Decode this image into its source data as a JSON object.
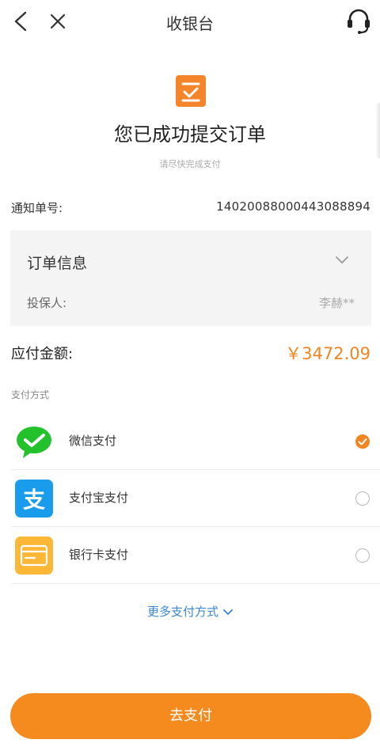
{
  "header": {
    "title": "收银台",
    "back_icon": "chevron-left-icon",
    "close_icon": "close-icon",
    "support_icon": "headset-icon"
  },
  "success": {
    "title": "您已成功提交订单",
    "subtitle": "请尽快完成支付",
    "icon": "order-check-icon",
    "icon_color": "#f5852a"
  },
  "notice": {
    "label": "通知单号:",
    "value": "14020088000443088894"
  },
  "order_info": {
    "title": "订单信息",
    "holder_label": "投保人:",
    "holder_value": "李赫**"
  },
  "amount": {
    "label": "应付金额:",
    "value": "￥3472.09",
    "color": "#f08522"
  },
  "payment": {
    "section_label": "支付方式",
    "methods": [
      {
        "name": "微信支付",
        "icon": "wechat-pay-icon",
        "selected": true,
        "color": "#23c12b"
      },
      {
        "name": "支付宝支付",
        "icon": "alipay-icon",
        "selected": false,
        "color": "#1a9cec"
      },
      {
        "name": "银行卡支付",
        "icon": "bank-card-icon",
        "selected": false,
        "color": "#fbb735"
      }
    ],
    "more_label": "更多支付方式"
  },
  "action": {
    "pay_label": "去支付",
    "color": "#f58a1e"
  }
}
